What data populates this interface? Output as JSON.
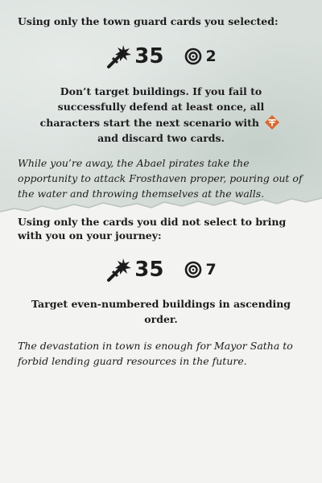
{
  "colors": {
    "top_panel": "#d9e0dc",
    "bottom_panel": "#f3f3f1",
    "text": "#1c1c1c",
    "condition_icon": "#e0662a"
  },
  "section1": {
    "intro": "Using only the town guard cards you selected:",
    "attack_icon": "attack-spark-sword-icon",
    "attack_value": "35",
    "defense_icon": "target-icon",
    "defense_value": "2",
    "instruction_part1": "Don’t target buildings. If you fail to successfully defend at least once, all characters start the next scenario with",
    "condition_icon": "impair-condition-icon",
    "instruction_part2": "and discard two cards.",
    "flavor": "While you’re away, the Abael pirates take the opportunity to attack Frosthaven proper, pouring out of the water and throwing themselves at the walls."
  },
  "section2": {
    "intro": "Using only the cards you did not select to bring with you on your journey:",
    "attack_icon": "attack-spark-sword-icon",
    "attack_value": "35",
    "defense_icon": "target-icon",
    "defense_value": "7",
    "instruction": "Target even-numbered buildings in ascending order.",
    "flavor": "The devastation in town is enough for Mayor Satha to forbid lending guard resources in the future."
  }
}
